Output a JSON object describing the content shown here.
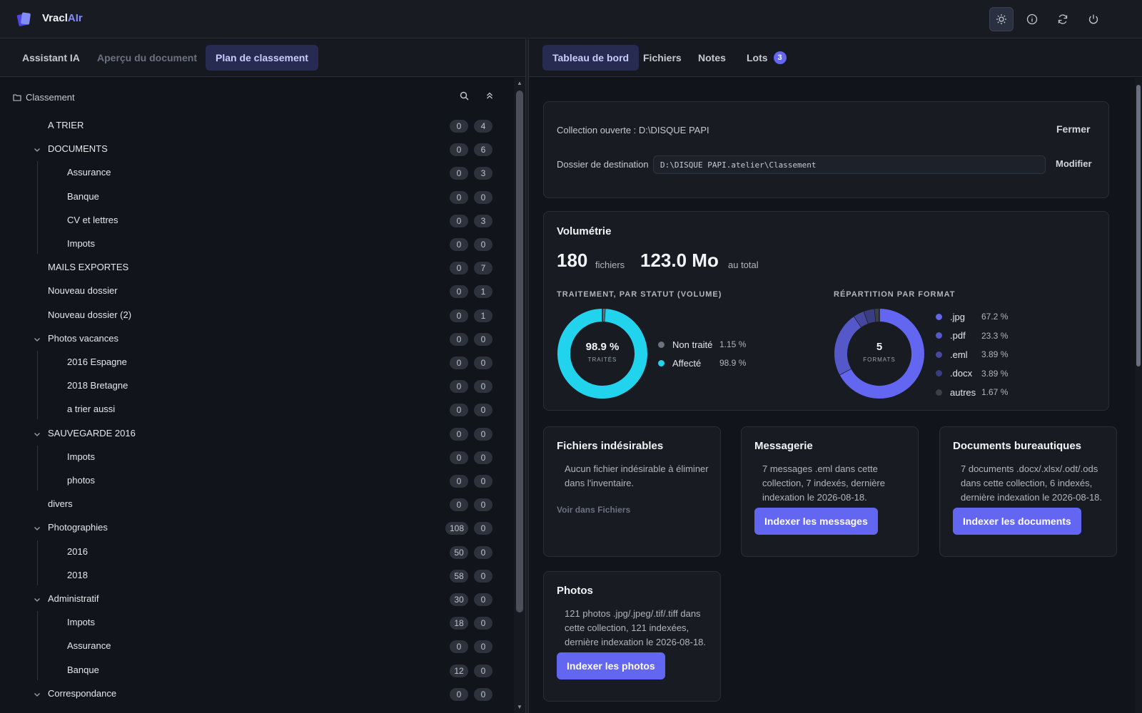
{
  "app": {
    "name_prefix": "Vracl",
    "name_ai": "AIr"
  },
  "toolbar": [
    {
      "icon": "sun-icon",
      "active": true
    },
    {
      "icon": "info-icon",
      "active": false
    },
    {
      "icon": "refresh-icon",
      "active": false
    },
    {
      "icon": "power-icon",
      "active": false
    }
  ],
  "left_tabs": {
    "assistant": "Assistant IA",
    "apercu": "Aperçu du document",
    "plan": "Plan de classement"
  },
  "right_tabs": {
    "dashboard": "Tableau de bord",
    "fichiers": "Fichiers",
    "notes": "Notes",
    "lots": "Lots",
    "lots_count": "3"
  },
  "tree": {
    "root_label": "Classement",
    "nodes": [
      {
        "label": "A TRIER",
        "c1": "0",
        "c2": "4",
        "level": 0,
        "chevron": false
      },
      {
        "label": "DOCUMENTS",
        "c1": "0",
        "c2": "6",
        "level": 0,
        "chevron": true
      },
      {
        "label": "Assurance",
        "c1": "0",
        "c2": "3",
        "level": 1,
        "chevron": false
      },
      {
        "label": "Banque",
        "c1": "0",
        "c2": "0",
        "level": 1,
        "chevron": false
      },
      {
        "label": "CV et lettres",
        "c1": "0",
        "c2": "3",
        "level": 1,
        "chevron": false
      },
      {
        "label": "Impots",
        "c1": "0",
        "c2": "0",
        "level": 1,
        "chevron": false
      },
      {
        "label": "MAILS EXPORTES",
        "c1": "0",
        "c2": "7",
        "level": 0,
        "chevron": false
      },
      {
        "label": "Nouveau dossier",
        "c1": "0",
        "c2": "1",
        "level": 0,
        "chevron": false
      },
      {
        "label": "Nouveau dossier (2)",
        "c1": "0",
        "c2": "1",
        "level": 0,
        "chevron": false
      },
      {
        "label": "Photos vacances",
        "c1": "0",
        "c2": "0",
        "level": 0,
        "chevron": true
      },
      {
        "label": "2016 Espagne",
        "c1": "0",
        "c2": "0",
        "level": 1,
        "chevron": false
      },
      {
        "label": "2018 Bretagne",
        "c1": "0",
        "c2": "0",
        "level": 1,
        "chevron": false
      },
      {
        "label": "a trier aussi",
        "c1": "0",
        "c2": "0",
        "level": 1,
        "chevron": false
      },
      {
        "label": "SAUVEGARDE 2016",
        "c1": "0",
        "c2": "0",
        "level": 0,
        "chevron": true
      },
      {
        "label": "Impots",
        "c1": "0",
        "c2": "0",
        "level": 1,
        "chevron": false
      },
      {
        "label": "photos",
        "c1": "0",
        "c2": "0",
        "level": 1,
        "chevron": false
      },
      {
        "label": "divers",
        "c1": "0",
        "c2": "0",
        "level": 0,
        "chevron": false
      },
      {
        "label": "Photographies",
        "c1": "108",
        "c2": "0",
        "level": 0,
        "chevron": true
      },
      {
        "label": "2016",
        "c1": "50",
        "c2": "0",
        "level": 1,
        "chevron": false
      },
      {
        "label": "2018",
        "c1": "58",
        "c2": "0",
        "level": 1,
        "chevron": false
      },
      {
        "label": "Administratif",
        "c1": "30",
        "c2": "0",
        "level": 0,
        "chevron": true
      },
      {
        "label": "Impots",
        "c1": "18",
        "c2": "0",
        "level": 1,
        "chevron": false
      },
      {
        "label": "Assurance",
        "c1": "0",
        "c2": "0",
        "level": 1,
        "chevron": false
      },
      {
        "label": "Banque",
        "c1": "12",
        "c2": "0",
        "level": 1,
        "chevron": false
      },
      {
        "label": "Correspondance",
        "c1": "0",
        "c2": "0",
        "level": 0,
        "chevron": true
      }
    ]
  },
  "collection": {
    "opened": "Collection ouverte : D:\\DISQUE PAPI",
    "close": "Fermer",
    "dest_label": "Dossier de destination",
    "dest_path": "D:\\DISQUE PAPI.atelier\\Classement",
    "modify": "Modifier"
  },
  "volumetrie": {
    "title": "Volumétrie",
    "files_value": "180",
    "files_unit": "fichiers",
    "size_value": "123.0 Mo",
    "size_unit": "au total",
    "status_title": "TRAITEMENT, PAR STATUT (VOLUME)",
    "status_center_value": "98.9 %",
    "status_center_label": "TRAITÉS",
    "status_legend": [
      {
        "label": "Non traité",
        "pct": "1.15 %",
        "value": 1.15,
        "color": "#6b7280"
      },
      {
        "label": "Affecté",
        "pct": "98.9 %",
        "value": 98.85,
        "color": "#22d3ee"
      }
    ],
    "format_title": "RÉPARTITION PAR FORMAT",
    "format_center_value": "5",
    "format_center_label": "FORMATS",
    "format_legend": [
      {
        "label": ".jpg",
        "pct": "67.2 %",
        "value": 67.2,
        "color": "#6366f1"
      },
      {
        "label": ".pdf",
        "pct": "23.3 %",
        "value": 23.3,
        "color": "#5458c8"
      },
      {
        "label": ".eml",
        "pct": "3.89 %",
        "value": 3.89,
        "color": "#45489e"
      },
      {
        "label": ".docx",
        "pct": "3.89 %",
        "value": 3.89,
        "color": "#3a3d80"
      },
      {
        "label": "autres",
        "pct": "1.67 %",
        "value": 1.67,
        "color": "#3b3f4a"
      }
    ]
  },
  "cards": {
    "indesirables": {
      "title": "Fichiers indésirables",
      "text1": "Aucun fichier indésirable à éliminer",
      "text2": "dans l'inventaire.",
      "link": "Voir dans Fichiers"
    },
    "messagerie": {
      "title": "Messagerie",
      "text1": "7 messages .eml dans cette",
      "text2": "collection, 7 indexés, dernière",
      "text3": "indexation le 2026-08-18.",
      "button": "Indexer les messages"
    },
    "bureautique": {
      "title": "Documents bureautiques",
      "text1": "7 documents .docx/.xlsx/.odt/.ods",
      "text2": "dans cette collection, 6 indexés,",
      "text3": "dernière indexation le 2026-08-18.",
      "button": "Indexer les documents"
    },
    "photos": {
      "title": "Photos",
      "text1": "121 photos .jpg/.jpeg/.tif/.tiff dans",
      "text2": "cette collection, 121 indexées,",
      "text3": "dernière indexation le 2026-08-18.",
      "button": "Indexer les photos"
    }
  }
}
